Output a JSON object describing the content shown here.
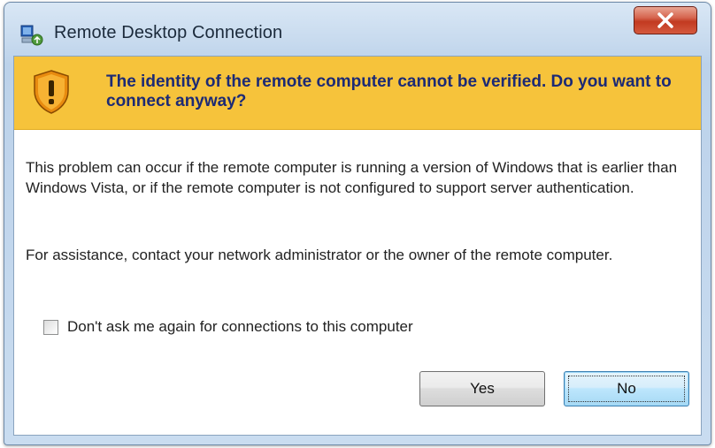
{
  "window": {
    "title": "Remote Desktop Connection",
    "icon": "remote-desktop-app-icon",
    "close_glyph": "X"
  },
  "banner": {
    "icon": "warning-shield-icon",
    "heading": "The identity of the remote computer cannot be verified. Do you want to connect anyway?",
    "color": "#f6c33b",
    "heading_color": "#1c2a75"
  },
  "body": {
    "paragraph1": "This problem can occur if the remote computer is running a version of Windows that is earlier than Windows Vista, or if the remote computer is not configured to support server authentication.",
    "paragraph2": "For assistance, contact your network administrator or the owner of the remote computer."
  },
  "checkbox": {
    "label": "Don't ask me again for connections to this computer",
    "checked": false
  },
  "buttons": {
    "yes": "Yes",
    "no": "No",
    "default": "no"
  }
}
